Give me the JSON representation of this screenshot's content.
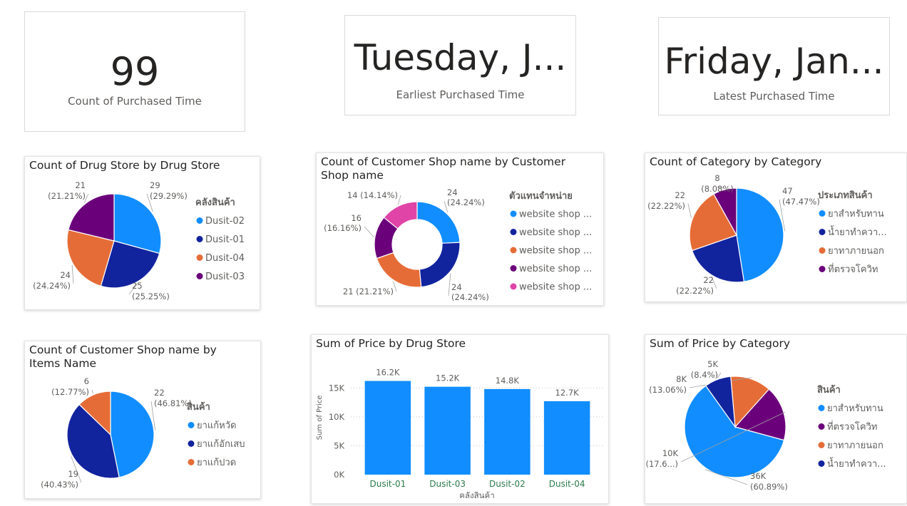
{
  "kpis": [
    {
      "value": "99",
      "label": "Count of Purchased Time"
    },
    {
      "value": "Tuesday, J...",
      "label": "Earliest Purchased Time"
    },
    {
      "value": "Friday, Jan...",
      "label": "Latest Purchased Time"
    }
  ],
  "colors": {
    "blue": "#118dff",
    "navy": "#12239e",
    "orange": "#e66c37",
    "purple": "#6b007b",
    "pink": "#e044a7"
  },
  "chart_data": [
    {
      "id": "drugstore_pie",
      "type": "pie",
      "title": "Count of Drug Store by Drug Store",
      "legend_title": "คลังสินค้า",
      "slices": [
        {
          "name": "Dusit-02",
          "value": 29,
          "label": "29",
          "pct": "(29.29%)",
          "color": "#118dff"
        },
        {
          "name": "Dusit-01",
          "value": 25,
          "label": "25",
          "pct": "(25.25%)",
          "color": "#12239e"
        },
        {
          "name": "Dusit-04",
          "value": 24,
          "label": "24",
          "pct": "(24.24%)",
          "color": "#e66c37"
        },
        {
          "name": "Dusit-03",
          "value": 21,
          "label": "21",
          "pct": "(21.21%)",
          "color": "#6b007b"
        }
      ]
    },
    {
      "id": "shop_donut",
      "type": "pie",
      "title": "Count of Customer Shop name by Customer Shop name",
      "legend_title": "ตัวแทนจำหน่าย",
      "slices": [
        {
          "name": "website shop ...",
          "value": 24,
          "label": "24",
          "pct": "(24.24%)",
          "color": "#118dff"
        },
        {
          "name": "website shop ...",
          "value": 24,
          "label": "24",
          "pct": "(24.24%)",
          "color": "#12239e"
        },
        {
          "name": "website shop ...",
          "value": 21,
          "label": "21 (21.21%)",
          "pct": "",
          "color": "#e66c37"
        },
        {
          "name": "website shop ...",
          "value": 16,
          "label": "16",
          "pct": "(16.16%)",
          "color": "#6b007b"
        },
        {
          "name": "website shop ...",
          "value": 14,
          "label": "14 (14.14%)",
          "pct": "",
          "color": "#e044a7"
        }
      ]
    },
    {
      "id": "category_pie",
      "type": "pie",
      "title": "Count of Category by Category",
      "legend_title": "ประเภทสินค้า",
      "slices": [
        {
          "name": "ยาสำหรับทาน",
          "value": 47,
          "label": "47",
          "pct": "(47.47%)",
          "color": "#118dff"
        },
        {
          "name": "น้ำยาทำควา...",
          "value": 22,
          "label": "22",
          "pct": "(22.22%)",
          "color": "#12239e"
        },
        {
          "name": "ยาทาภายนอก",
          "value": 22,
          "label": "22",
          "pct": "(22.22%)",
          "color": "#e66c37"
        },
        {
          "name": "ที่ตรวจโควิท",
          "value": 8,
          "label": "8",
          "pct": "(8.08%)",
          "color": "#6b007b"
        }
      ]
    },
    {
      "id": "items_pie",
      "type": "pie",
      "title": "Count of Customer Shop name by Items Name",
      "legend_title": "สินค้า",
      "slices": [
        {
          "name": "ยาแก้หวัด",
          "value": 22,
          "label": "22",
          "pct": "(46.81%)",
          "color": "#118dff"
        },
        {
          "name": "ยาแก้อักเสบ",
          "value": 19,
          "label": "19",
          "pct": "(40.43%)",
          "color": "#12239e"
        },
        {
          "name": "ยาแก้ปวด",
          "value": 6,
          "label": "6",
          "pct": "(12.77%)",
          "color": "#e66c37"
        }
      ]
    },
    {
      "id": "price_bar",
      "type": "bar",
      "title": "Sum of Price by Drug Store",
      "xlabel": "คลังสินค้า",
      "ylabel": "Sum of Price",
      "categories": [
        "Dusit-01",
        "Dusit-03",
        "Dusit-02",
        "Dusit-04"
      ],
      "values": [
        16200,
        15200,
        14800,
        12700
      ],
      "data_labels": [
        "16.2K",
        "15.2K",
        "14.8K",
        "12.7K"
      ],
      "yticks": [
        0,
        5000,
        10000,
        15000
      ],
      "ytick_labels": [
        "0K",
        "5K",
        "10K",
        "15K"
      ],
      "ylim": [
        0,
        17500
      ],
      "color": "#118dff"
    },
    {
      "id": "price_category_pie",
      "type": "pie",
      "title": "Sum of Price by Category",
      "legend_title": "สินค้า",
      "slices": [
        {
          "name": "ยาสำหรับทาน",
          "value": 36,
          "label": "36K",
          "pct": "(60.89%)",
          "color": "#118dff"
        },
        {
          "name": "ที่ตรวจโควิท",
          "value": 10.4,
          "label": "10K",
          "pct": "(17.6...)",
          "color": "#6b007b"
        },
        {
          "name": "ยาทาภายนอก",
          "value": 7.7,
          "label": "8K",
          "pct": "(13.06%)",
          "color": "#e66c37"
        },
        {
          "name": "น้ำยาทำควา...",
          "value": 5,
          "label": "5K",
          "pct": "(8.4%)",
          "color": "#12239e"
        }
      ]
    }
  ]
}
